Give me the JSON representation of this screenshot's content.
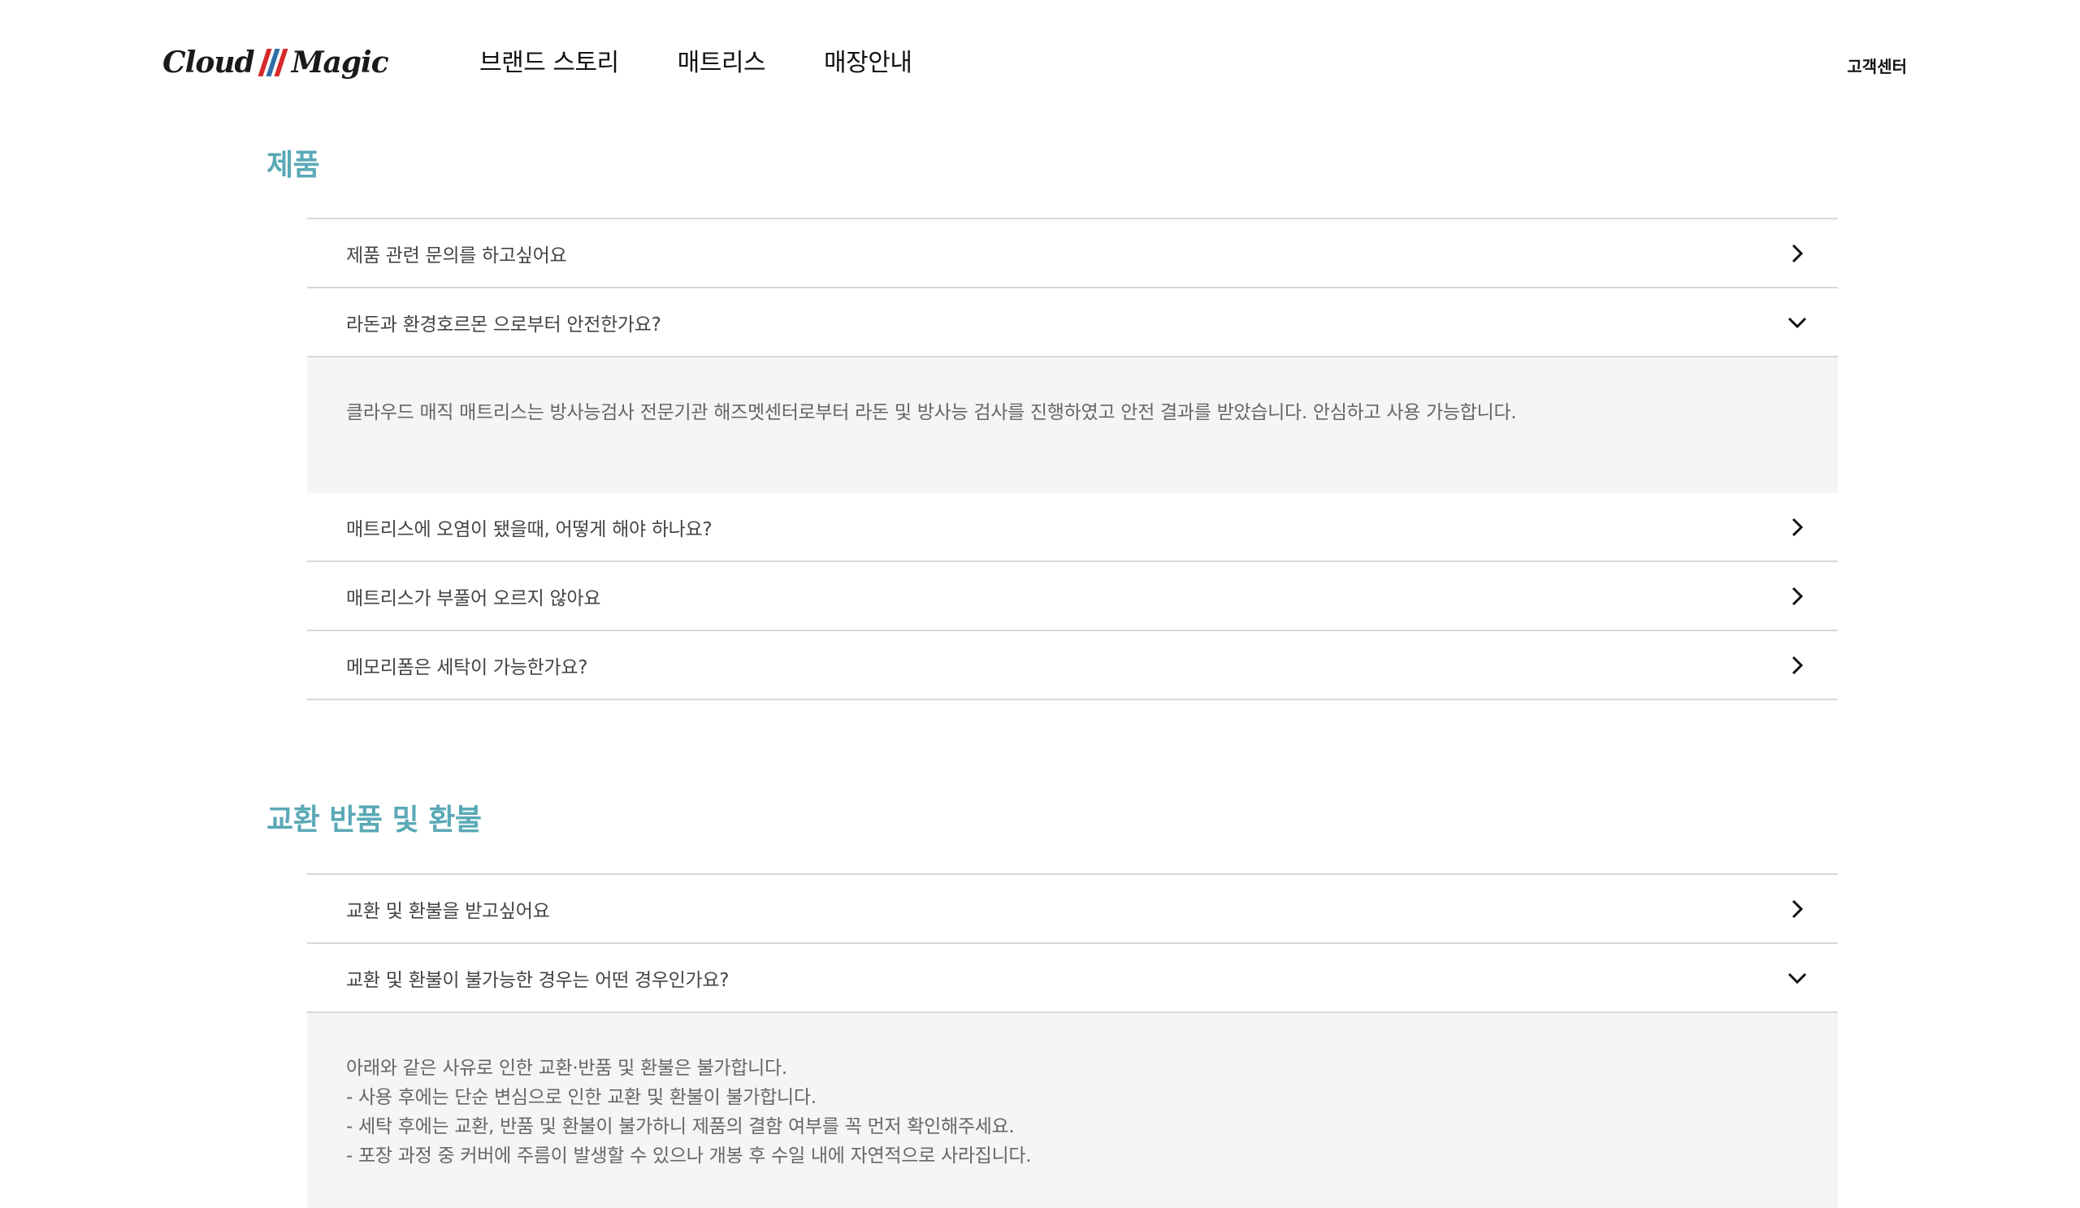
{
  "brand": {
    "logo_left": "Cloud",
    "logo_right": "Magic",
    "mark_colors": [
      "#d62a2a",
      "#2f6fa8",
      "#d62a2a"
    ]
  },
  "nav": {
    "items": [
      {
        "label": "브랜드 스토리"
      },
      {
        "label": "매트리스"
      },
      {
        "label": "매장안내"
      }
    ],
    "customer_center": "고객센터"
  },
  "colors": {
    "section_title": "#5aa9b6",
    "answer_bg": "#f5f5f5",
    "divider": "#d8d8d8"
  },
  "sections": [
    {
      "title": "제품",
      "items": [
        {
          "question": "제품 관련 문의를 하고싶어요",
          "icon": "chevron-right-icon"
        },
        {
          "question": "라돈과 환경호르몬 으로부터 안전한가요?",
          "icon": "chevron-down-icon",
          "answer": [
            "클라우드 매직 매트리스는 방사능검사 전문기관 해즈멧센터로부터 라돈 및 방사능 검사를 진행하였고 안전 결과를 받았습니다. 안심하고 사용 가능합니다."
          ]
        },
        {
          "question": "매트리스에 오염이 됐을때, 어떻게 해야 하나요?",
          "icon": "chevron-right-icon"
        },
        {
          "question": "매트리스가 부풀어 오르지 않아요",
          "icon": "chevron-right-icon"
        },
        {
          "question": "메모리폼은 세탁이 가능한가요?",
          "icon": "chevron-right-icon"
        }
      ]
    },
    {
      "title": "교환 반품 및 환불",
      "items": [
        {
          "question": "교환 및 환불을 받고싶어요",
          "icon": "chevron-right-icon"
        },
        {
          "question": "교환 및 환불이 불가능한 경우는 어떤 경우인가요?",
          "icon": "chevron-down-icon",
          "answer": [
            "아래와 같은 사유로 인한 교환·반품 및 환불은 불가합니다.",
            "- 사용 후에는 단순 변심으로 인한 교환 및 환불이 불가합니다.",
            "- 세탁 후에는 교환, 반품 및 환불이 불가하니 제품의 결함 여부를 꼭 먼저 확인해주세요.",
            "- 포장 과정 중 커버에 주름이 발생할 수 있으나 개봉 후 수일 내에 자연적으로 사라집니다."
          ]
        }
      ]
    }
  ]
}
